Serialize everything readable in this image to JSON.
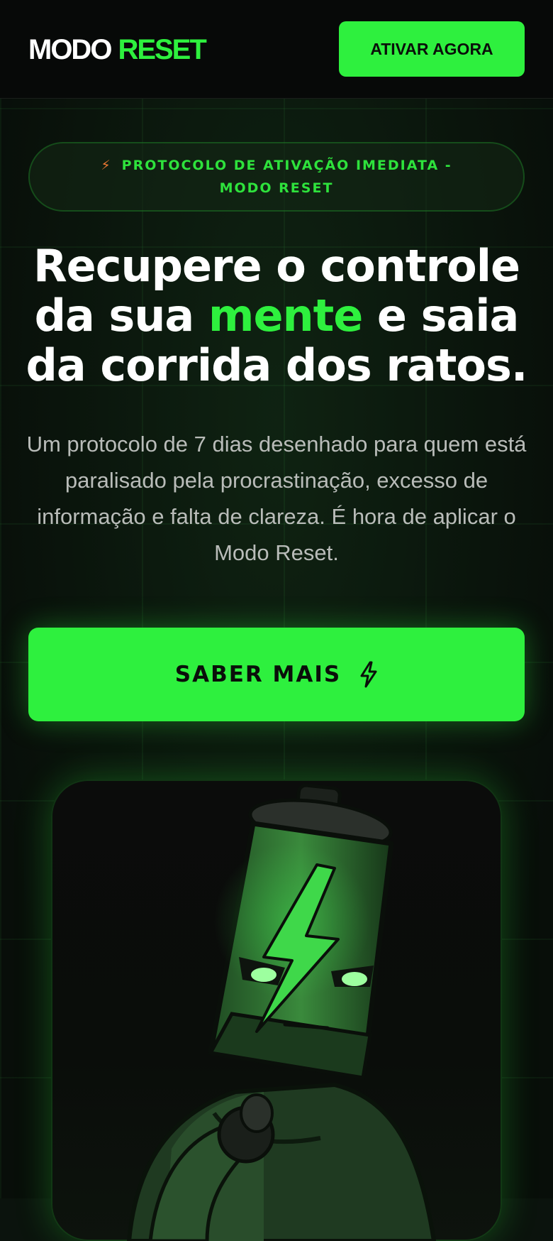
{
  "header": {
    "logo_part1": "MODO",
    "logo_part2": "RESET",
    "cta_label": "ATIVAR AGORA"
  },
  "hero": {
    "badge_icon": "lightning-bolt-icon",
    "badge_text": "PROTOCOLO DE ATIVAÇÃO IMEDIATA - MODO RESET",
    "headline_part1": "Recupere o controle da sua ",
    "headline_highlight": "mente",
    "headline_part2": " e saia da corrida dos ratos.",
    "subheadline": "Um protocolo de 7 dias desenhado para quem está paralisado pela procrastinação, excesso de informação e falta de clareza. É hora de aplicar o Modo Reset.",
    "cta_label": "SABER MAIS",
    "cta_icon": "lightning-bolt-icon",
    "illustration": "battery-character-pointing-illustration"
  },
  "colors": {
    "accent": "#2ef03e",
    "background": "#0c150e",
    "header_bg": "#070908",
    "badge_bolt": "#f07a34",
    "text_muted": "#b9bcb9"
  }
}
